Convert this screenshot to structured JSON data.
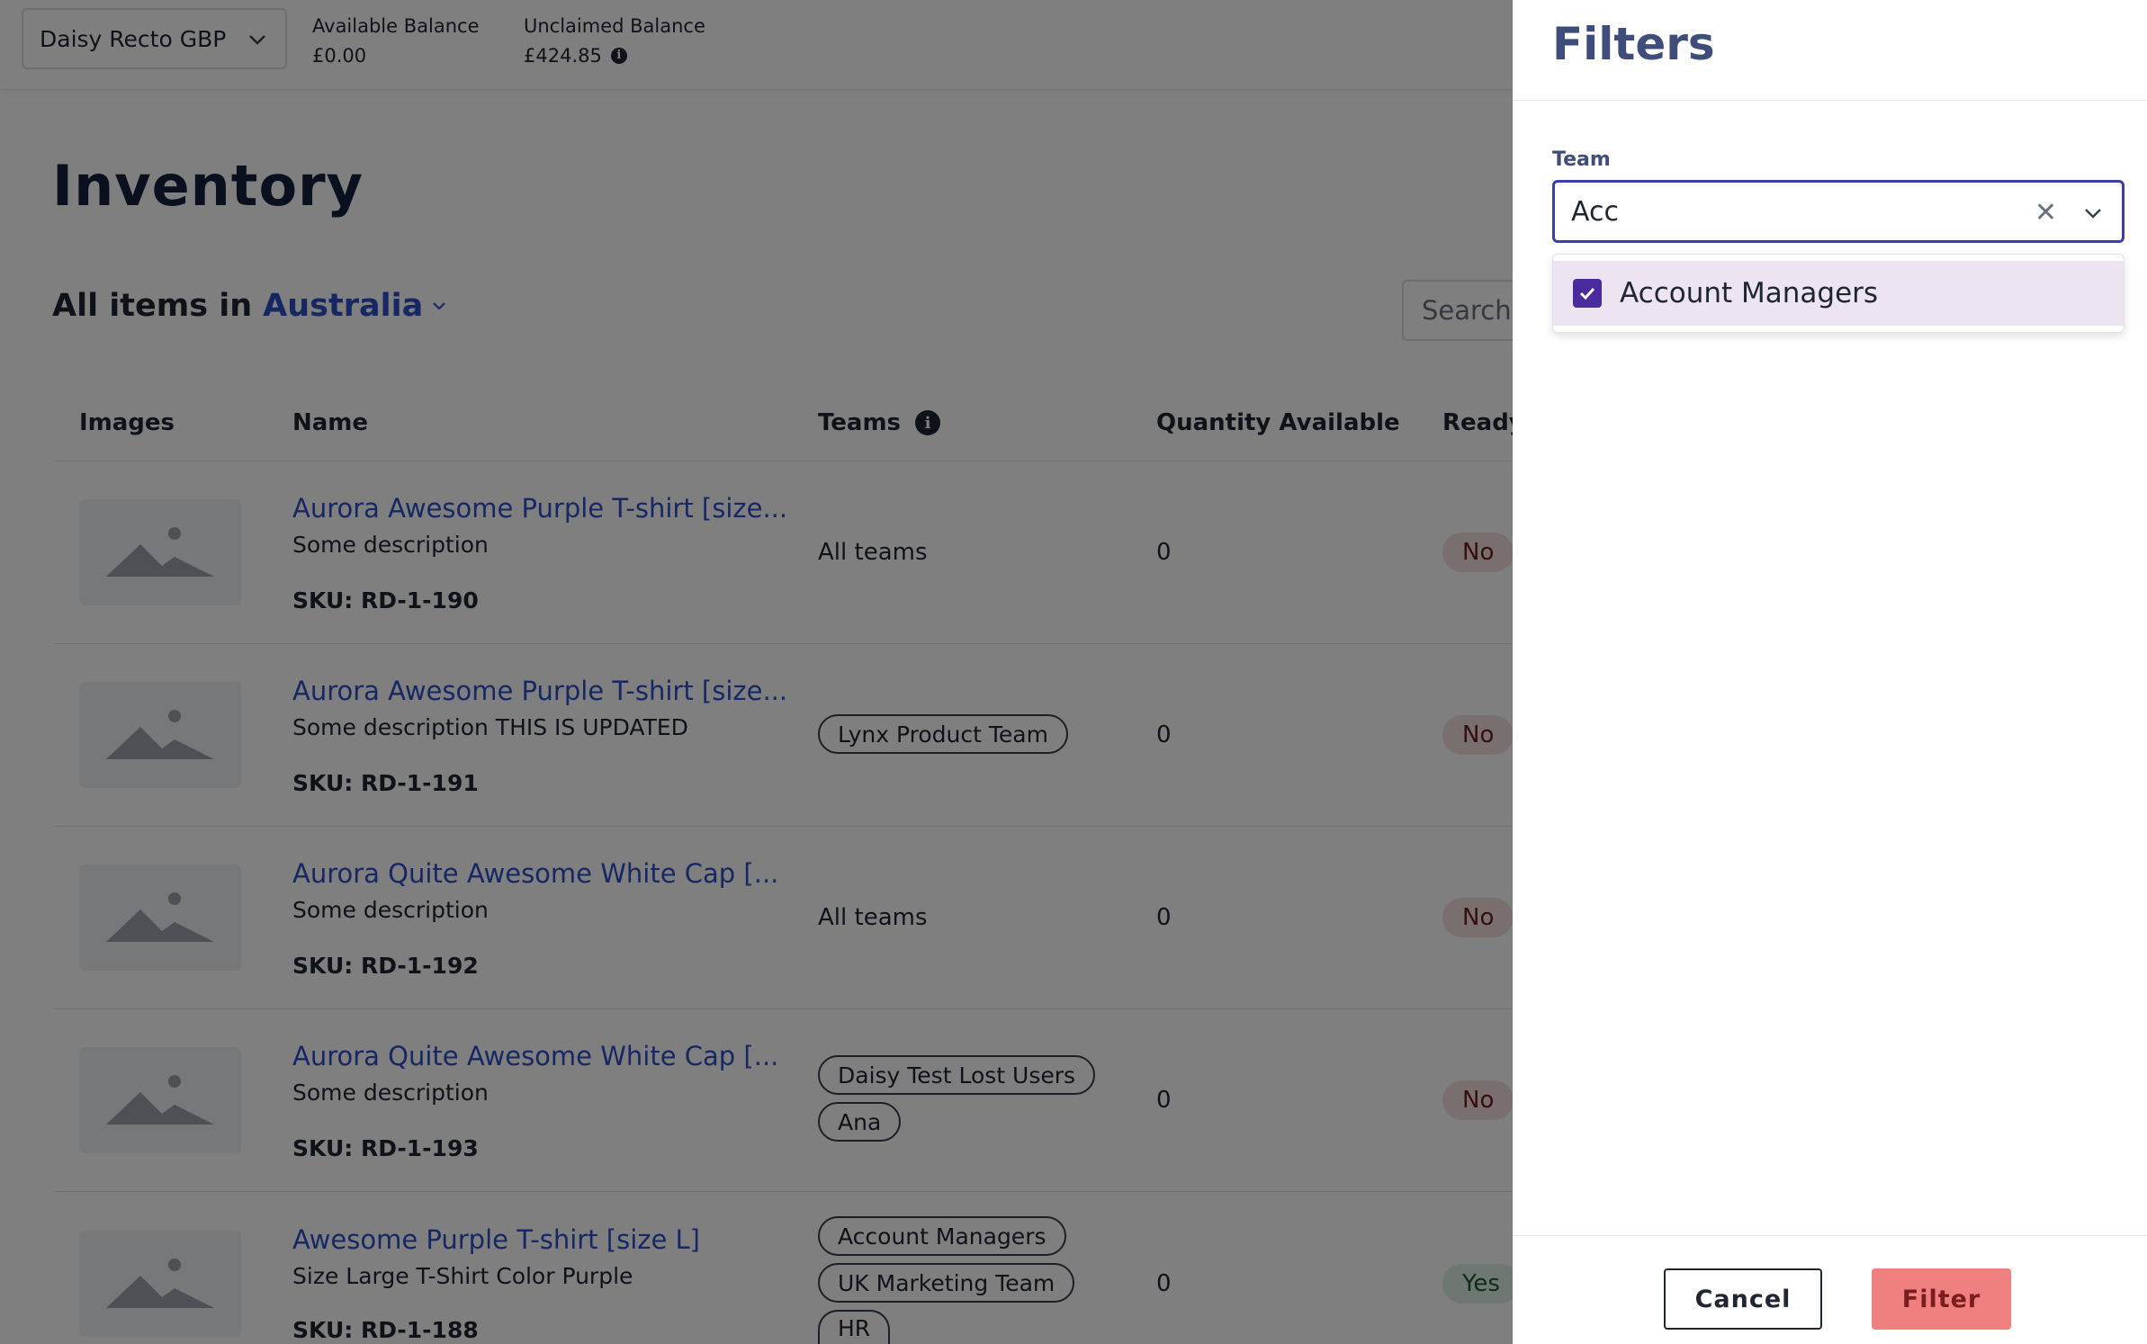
{
  "topbar": {
    "account": "Daisy Recto GBP",
    "available_label": "Available Balance",
    "available_value": "£0.00",
    "unclaimed_label": "Unclaimed Balance",
    "unclaimed_value": "£424.85"
  },
  "page": {
    "title": "Inventory",
    "items_in_label": "All items in",
    "location": "Australia",
    "search_placeholder": "Search I"
  },
  "table": {
    "headers": {
      "images": "Images",
      "name": "Name",
      "teams": "Teams",
      "quantity": "Quantity Available",
      "ready": "Ready"
    },
    "rows": [
      {
        "name": "Aurora Awesome Purple T-shirt [size...",
        "description": "Some description",
        "sku": "SKU: RD-1-190",
        "teams_text": "All teams",
        "quantity": "0",
        "ready": "No"
      },
      {
        "name": "Aurora Awesome Purple T-shirt [size...",
        "description": "Some description THIS IS UPDATED",
        "sku": "SKU: RD-1-191",
        "teams": [
          "Lynx Product Team"
        ],
        "quantity": "0",
        "ready": "No"
      },
      {
        "name": "Aurora Quite Awesome White Cap [...",
        "description": "Some description",
        "sku": "SKU: RD-1-192",
        "teams_text": "All teams",
        "quantity": "0",
        "ready": "No"
      },
      {
        "name": "Aurora Quite Awesome White Cap [...",
        "description": "Some description",
        "sku": "SKU: RD-1-193",
        "teams": [
          "Daisy Test Lost Users",
          "Ana"
        ],
        "quantity": "0",
        "ready": "No"
      },
      {
        "name": "Awesome Purple T-shirt [size L]",
        "description": "Size Large T-Shirt Color Purple",
        "sku": "SKU: RD-1-188",
        "teams": [
          "Account Managers",
          "UK Marketing Team",
          "HR"
        ],
        "quantity": "0",
        "ready": "Yes"
      }
    ]
  },
  "filters": {
    "title": "Filters",
    "team_label": "Team",
    "team_input_value": "Acc",
    "options": [
      {
        "label": "Account Managers",
        "checked": true
      }
    ],
    "cancel_label": "Cancel",
    "filter_label": "Filter"
  },
  "colors": {
    "link": "#2f4fc9",
    "heading": "#14213d",
    "panel_title": "#3f4d7a",
    "checkbox": "#4b2a9e",
    "filter_button": "#f08080",
    "input_focus": "#3b3fa8"
  }
}
